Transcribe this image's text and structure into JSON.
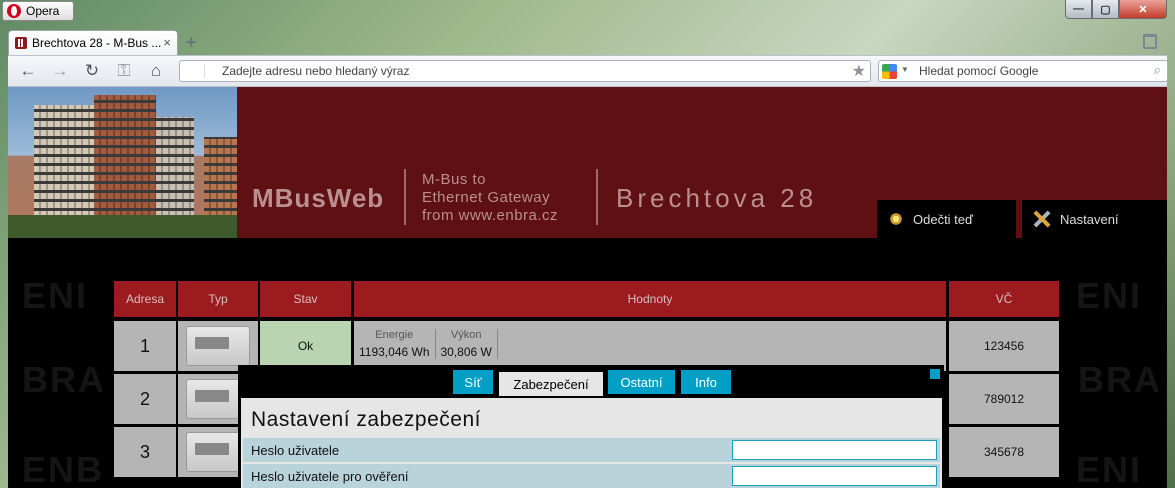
{
  "browser": {
    "menu_label": "Opera",
    "tab_title": "Brechtova 28 - M-Bus ...",
    "tab_close": "×",
    "new_tab": "+",
    "address_placeholder": "Zadejte adresu nebo hledaný výraz",
    "search_placeholder": "Hledat pomocí Google",
    "window_controls": {
      "minimize": "—",
      "maximize": "▢",
      "close": "✕"
    }
  },
  "header": {
    "logo": "MBusWeb",
    "subtitle": [
      "M-Bus to",
      "Ethernet Gateway",
      "from www.enbra.cz"
    ],
    "building_name": "Brechtova 28",
    "buttons": {
      "read_now": "Odečti teď",
      "settings": "Nastavení"
    }
  },
  "watermark": {
    "left_top": "ENI",
    "left_mid": "BRA",
    "right_top": "ENI",
    "right_mid": "BRA",
    "left_bottom": "ENB",
    "right_bottom": "ENI"
  },
  "table": {
    "headers": [
      "Adresa",
      "Typ",
      "Stav",
      "Hodnoty",
      "VČ"
    ],
    "rows": [
      {
        "address": "1",
        "status": "Ok",
        "values": [
          {
            "label": "Energie",
            "value": "1193,046 Wh"
          },
          {
            "label": "Výkon",
            "value": "30,806 W"
          }
        ],
        "serial": "123456"
      },
      {
        "address": "2",
        "serial": "789012"
      },
      {
        "address": "3",
        "serial": "345678"
      }
    ]
  },
  "dialog": {
    "tabs": [
      "Síť",
      "Zabezpečení",
      "Ostatní",
      "Info"
    ],
    "active_tab": "Zabezpečení",
    "title": "Nastavení zabezpečení",
    "fields": [
      {
        "label": "Heslo uživatele",
        "value": ""
      },
      {
        "label": "Heslo uživatele pro ověření",
        "value": ""
      }
    ]
  },
  "colors": {
    "header_bg": "#5e1013",
    "table_header": "#9b1b1f",
    "accent": "#00a0c6",
    "ok": "#b8d4b0"
  }
}
